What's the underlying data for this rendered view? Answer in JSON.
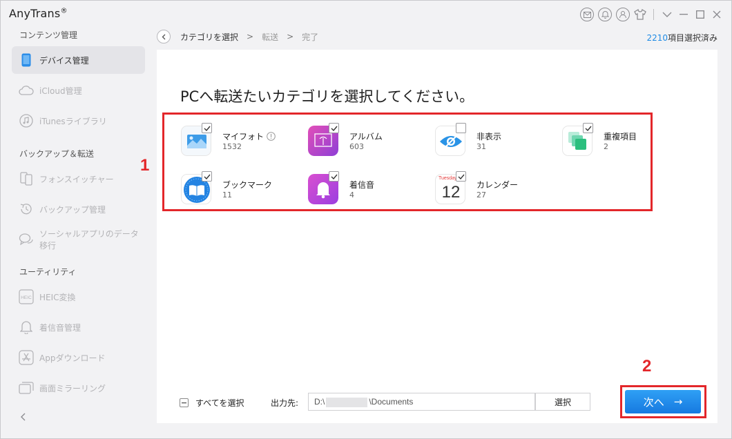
{
  "app": {
    "title": "AnyTrans",
    "trademark": "®"
  },
  "titlebar": {
    "icons": [
      "mail-icon",
      "bell-icon",
      "user-icon",
      "shirt-icon",
      "chevron-down-icon",
      "minimize-icon",
      "maximize-icon",
      "close-icon"
    ]
  },
  "sidebar": {
    "sections": [
      {
        "title": "コンテンツ管理"
      },
      {
        "title": "バックアップ＆転送"
      },
      {
        "title": "ユーティリティ"
      }
    ],
    "items": [
      {
        "label": "デバイス管理",
        "icon": "device-icon",
        "active": true
      },
      {
        "label": "iCloud管理",
        "icon": "cloud-icon"
      },
      {
        "label": "iTunesライブラリ",
        "icon": "music-note-icon"
      },
      {
        "label": "フォンスイッチャー",
        "icon": "phone-switch-icon"
      },
      {
        "label": "バックアップ管理",
        "icon": "backup-clock-icon"
      },
      {
        "label": "ソーシャルアプリのデータ移行",
        "icon": "chat-bubble-icon"
      },
      {
        "label": "HEIC変換",
        "icon": "heic-icon"
      },
      {
        "label": "着信音管理",
        "icon": "bell-icon"
      },
      {
        "label": "Appダウンロード",
        "icon": "app-store-icon"
      },
      {
        "label": "画面ミラーリング",
        "icon": "screen-mirror-icon"
      }
    ]
  },
  "breadcrumb": {
    "steps": [
      "カテゴリを選択",
      "転送",
      "完了"
    ],
    "separator": ">"
  },
  "selection": {
    "count": "2210",
    "suffix": "項目選択済み"
  },
  "main": {
    "heading": "PCへ転送たいカテゴリを選択してください。"
  },
  "categories": [
    {
      "name": "マイフォト",
      "count": "1532",
      "checked": true,
      "icon": "photo-icon",
      "info": true
    },
    {
      "name": "アルバム",
      "count": "603",
      "checked": true,
      "icon": "album-icon"
    },
    {
      "name": "非表示",
      "count": "31",
      "checked": false,
      "icon": "hidden-eye-icon"
    },
    {
      "name": "重複項目",
      "count": "2",
      "checked": true,
      "icon": "duplicate-icon"
    },
    {
      "name": "ブックマーク",
      "count": "11",
      "checked": true,
      "icon": "bookmark-book-icon"
    },
    {
      "name": "着信音",
      "count": "4",
      "checked": true,
      "icon": "ringtone-bell-icon"
    },
    {
      "name": "カレンダー",
      "count": "27",
      "checked": true,
      "icon": "calendar-icon",
      "calendar_day": "Tuesday",
      "calendar_date": "12"
    }
  ],
  "footer": {
    "select_all": "すべてを選択",
    "output_label": "出力先:",
    "path_prefix": "D:\\",
    "path_suffix": "\\Documents",
    "choose_button": "選択",
    "next_button": "次へ",
    "next_arrow": "→"
  },
  "annotations": [
    {
      "number": "1"
    },
    {
      "number": "2"
    }
  ],
  "colors": {
    "accent": "#1f8be5",
    "annotation": "#e3262a"
  }
}
